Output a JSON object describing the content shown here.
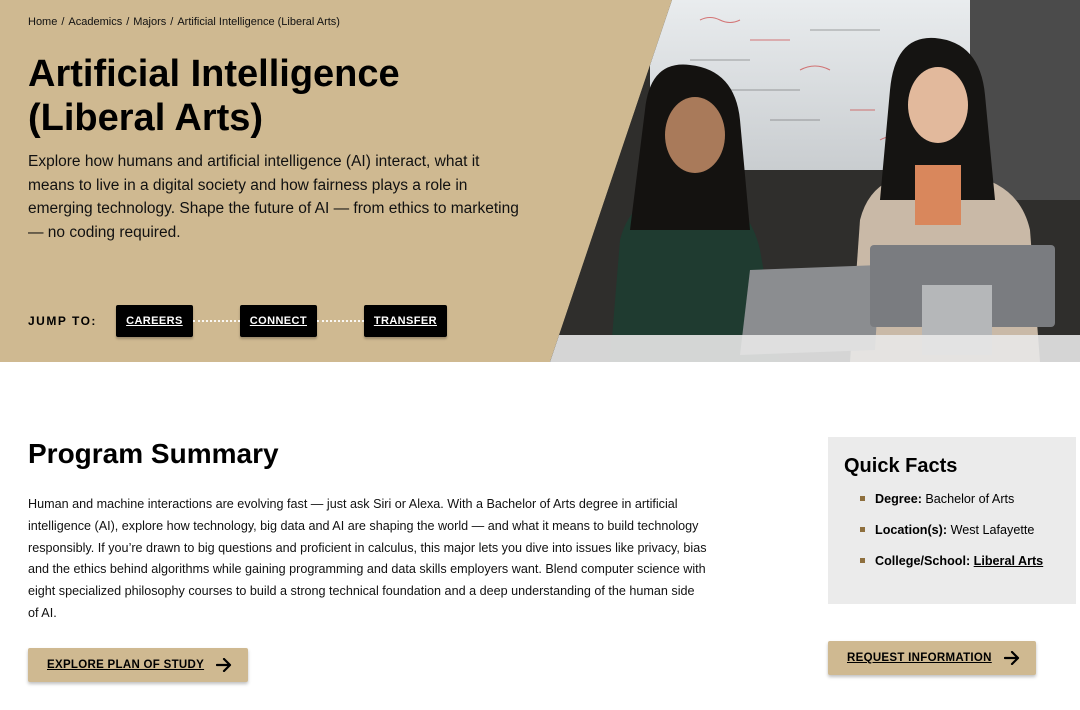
{
  "breadcrumb": {
    "home": "Home",
    "academics": "Academics",
    "majors": "Majors",
    "current": "Artificial Intelligence (Liberal Arts)",
    "separator": "/"
  },
  "hero": {
    "title_line1": "Artificial Intelligence",
    "title_line2": "(Liberal Arts)",
    "description": "Explore how humans and artificial intelligence (AI) interact, what it means to live in a digital society and how fairness plays a role in emerging technology. Shape the future of AI — from ethics to marketing — no coding required.",
    "background_color": "#cfb991"
  },
  "jump_to": {
    "label": "JUMP TO:",
    "buttons": [
      "CAREERS",
      "CONNECT",
      "TRANSFER"
    ]
  },
  "summary": {
    "title": "Program Summary",
    "text": "Human and machine interactions are evolving fast — just ask Siri or Alexa. With a Bachelor of Arts degree in artificial intelligence (AI), explore how technology, big data and AI are shaping the world — and what it means to build technology responsibly. If you’re drawn to big questions and proficient in calculus, this major lets you dive into issues like privacy, bias and the ethics behind algorithms while gaining programming and data skills employers want. Blend computer science with eight specialized philosophy courses to build a strong technical foundation and a deep understanding of the human side of AI.",
    "plan_button": "EXPLORE PLAN OF STUDY"
  },
  "quick_facts": {
    "title": "Quick Facts",
    "degree_label": "Degree:",
    "degree_value": "Bachelor of Arts",
    "location_label": "Location(s):",
    "location_value": "West Lafayette",
    "college_label": "College/School:",
    "college_value": "Liberal Arts"
  },
  "request_button": "REQUEST INFORMATION",
  "icons": {
    "arrow": "arrow-right-icon"
  }
}
